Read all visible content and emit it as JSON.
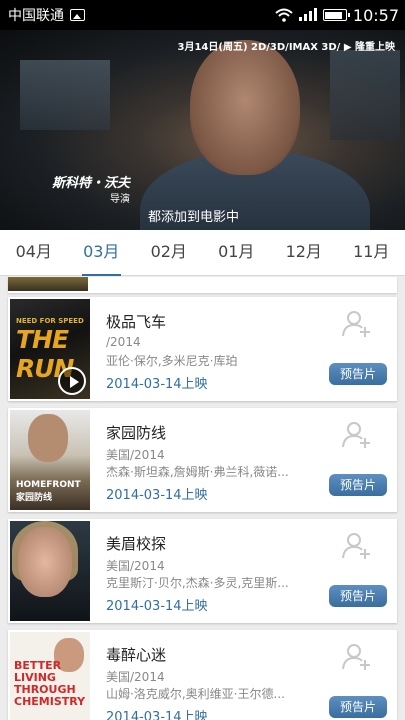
{
  "status_bar": {
    "carrier": "中国联通",
    "time": "10:57"
  },
  "video": {
    "premiere": "3月14日(周五) 2D/3D/IMAX 3D/ ▶ 隆重上映",
    "name": "斯科特・沃夫",
    "role": "导演",
    "subtitle": "都添加到电影中"
  },
  "tabs": [
    "04月",
    "03月",
    "02月",
    "01月",
    "12月",
    "11月"
  ],
  "active_tab": "03月",
  "movies": [
    {
      "title": "极品飞车",
      "meta": "/2014",
      "cast": "亚伦·保尔,多米尼克·库珀",
      "date": "2014-03-14上映",
      "trailer": "预告片",
      "poster_text1": "NEED FOR SPEED",
      "poster_text2": "THE RUN"
    },
    {
      "title": "家园防线",
      "meta": "美国/2014",
      "cast": "杰森·斯坦森,詹姆斯·弗兰科,薇诺...",
      "date": "2014-03-14上映",
      "trailer": "预告片",
      "poster_text1": "HOMEFRONT 家园防线"
    },
    {
      "title": "美眉校探",
      "meta": "美国/2014",
      "cast": "克里斯汀·贝尔,杰森·多灵,克里斯...",
      "date": "2014-03-14上映",
      "trailer": "预告片"
    },
    {
      "title": "毒醉心迷",
      "meta": "美国/2014",
      "cast": "山姆·洛克威尔,奥利维亚·王尔德...",
      "date": "2014-03-14上映",
      "trailer": "预告片",
      "poster_text1": "BETTER LIVING THROUGH CHEMISTRY"
    }
  ],
  "colors": {
    "accent": "#2f6fa3",
    "trailer_button": "#4a7fb2"
  }
}
